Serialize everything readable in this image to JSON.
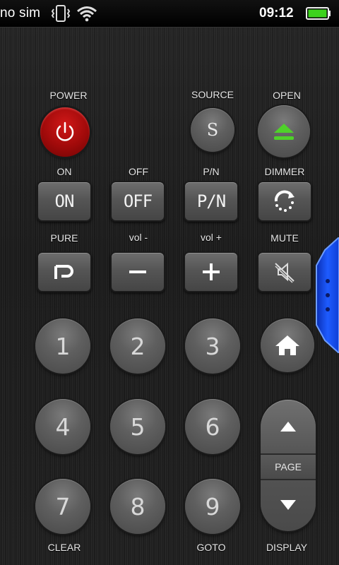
{
  "status_bar": {
    "carrier": "no sim",
    "time": "09:12",
    "icons": [
      "vibrate-icon",
      "wifi-icon",
      "battery-icon"
    ]
  },
  "remote": {
    "row1": {
      "power": {
        "label": "POWER",
        "icon": "power-icon"
      },
      "source": {
        "label": "SOURCE",
        "button_text": "S"
      },
      "open": {
        "label": "OPEN",
        "icon": "eject-icon"
      }
    },
    "row2": {
      "on": {
        "label": "ON",
        "button_text": "ON"
      },
      "off": {
        "label": "OFF",
        "button_text": "OFF"
      },
      "pn": {
        "label": "P/N",
        "button_text": "P/N"
      },
      "dimmer": {
        "label": "DIMMER",
        "icon": "dimmer-icon"
      }
    },
    "row3": {
      "pure": {
        "label": "PURE",
        "icon": "pure-icon"
      },
      "vol_down": {
        "label": "vol -",
        "icon": "minus-icon"
      },
      "vol_up": {
        "label": "vol +",
        "icon": "plus-icon"
      },
      "mute": {
        "label": "MUTE",
        "icon": "mute-icon"
      }
    },
    "keypad": [
      "1",
      "2",
      "3",
      "4",
      "5",
      "6",
      "7",
      "8",
      "9"
    ],
    "home": {
      "icon": "home-icon"
    },
    "page": {
      "label": "PAGE",
      "up_icon": "arrow-up-icon",
      "down_icon": "arrow-down-icon"
    },
    "bottom_labels": {
      "clear": "CLEAR",
      "goto": "GOTO",
      "display": "DISPLAY"
    }
  },
  "colors": {
    "power_red": "#c41010",
    "eject_green": "#4fd12a",
    "side_tab_blue": "#1e5cff",
    "battery_green": "#3cd21c"
  }
}
